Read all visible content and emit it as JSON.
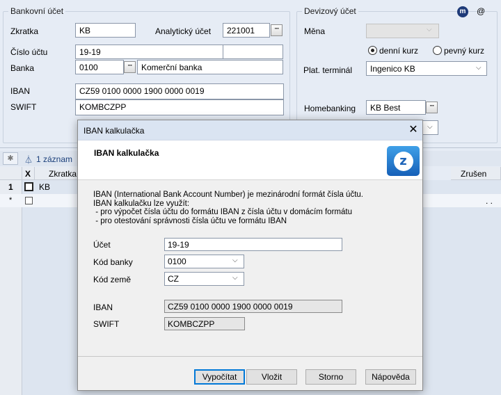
{
  "bank_account": {
    "legend": "Bankovní účet",
    "abbrev_label": "Zkratka",
    "abbrev_value": "KB",
    "analytic_label": "Analytický účet",
    "analytic_value": "221001",
    "account_label": "Číslo účtu",
    "account_value": "19-19",
    "bank_label": "Banka",
    "bank_code": "0100",
    "bank_name": "Komerční banka",
    "iban_label": "IBAN",
    "iban_value": "CZ59 0100 0000 1900 0000 0019",
    "swift_label": "SWIFT",
    "swift_value": "KOMBCZPP"
  },
  "currency": {
    "legend": "Devizový účet",
    "currency_label": "Měna",
    "currency_value": "",
    "rate_daily": "denní kurz",
    "rate_fixed": "pevný kurz",
    "selected_rate": "daily",
    "terminal_label": "Plat. terminál",
    "terminal_value": "Ingenico KB",
    "homebanking_label": "Homebanking",
    "homebanking_value": "KB Best",
    "at_icon": "@"
  },
  "grid": {
    "record_count": "1 záznam",
    "col_x": "X",
    "col_abbrev": "Zkratka",
    "col_cancelled": "Zrušen",
    "rows": [
      {
        "num": "1",
        "abbrev": "KB"
      },
      {
        "num": "*",
        "abbrev": "",
        "tail": ". ."
      }
    ]
  },
  "dialog": {
    "title": "IBAN kalkulačka",
    "header": "IBAN kalkulačka",
    "desc_1": "IBAN (International Bank Account Number) je mezinárodní formát čísla účtu.",
    "desc_2": "IBAN kalkulačku lze využít:",
    "desc_3": " - pro výpočet čísla účtu do formátu IBAN z čísla účtu v domácím formátu",
    "desc_4": " - pro otestování správnosti čísla účtu ve formátu IBAN",
    "account_label": "Účet",
    "account_value": "19-19",
    "bank_code_label": "Kód banky",
    "bank_code_value": "0100",
    "country_label": "Kód země",
    "country_value": "CZ",
    "iban_label": "IBAN",
    "iban_value": "CZ59 0100 0000 1900 0000 0019",
    "swift_label": "SWIFT",
    "swift_value": "KOMBCZPP",
    "btn_calculate": "Vypočítat",
    "btn_insert": "Vložit",
    "btn_cancel": "Storno",
    "btn_help": "Nápověda"
  }
}
